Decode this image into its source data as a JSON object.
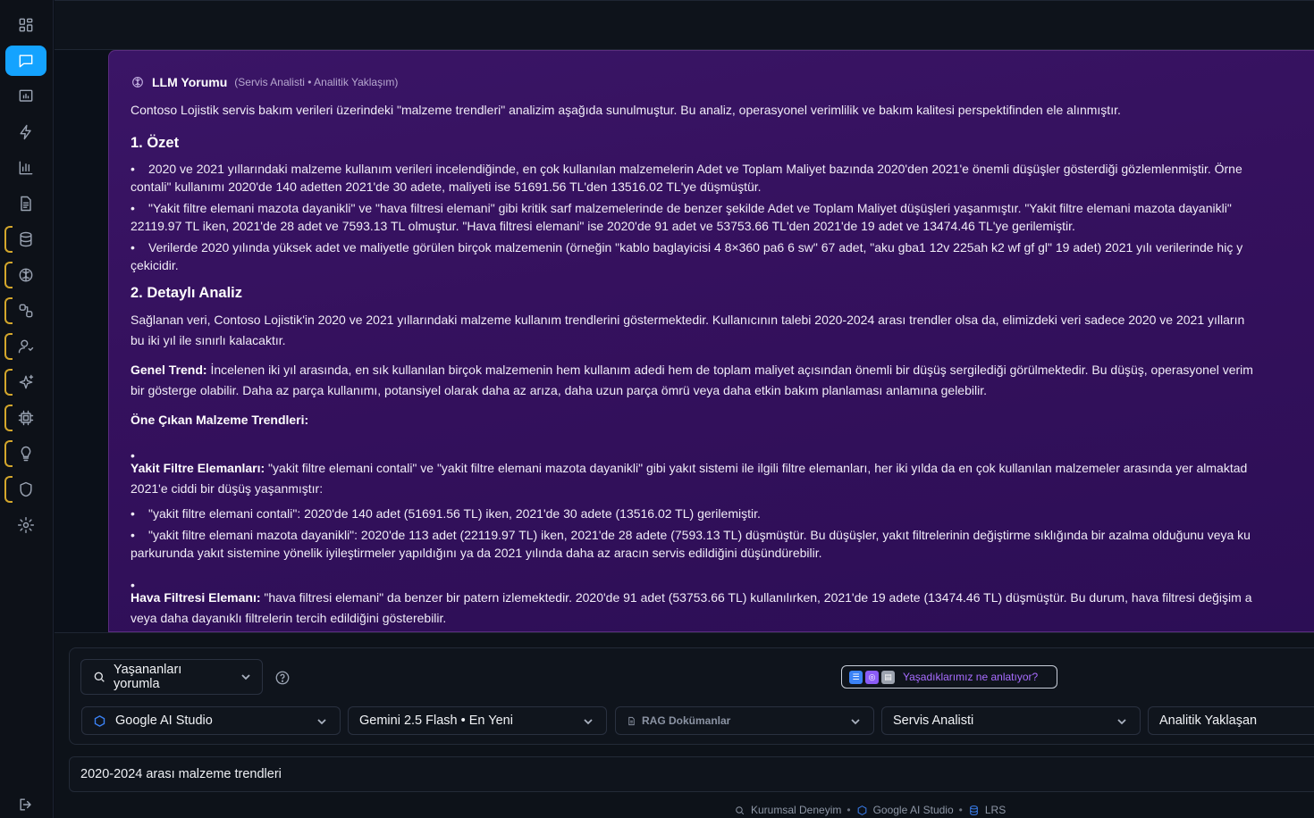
{
  "sidebar": {
    "items": [
      {
        "icon": "dashboard-icon"
      },
      {
        "icon": "chat-icon"
      },
      {
        "icon": "presentation-chart-icon"
      },
      {
        "icon": "lightning-icon"
      },
      {
        "icon": "bar-chart-icon"
      },
      {
        "icon": "document-icon"
      },
      {
        "icon": "database-icon"
      },
      {
        "icon": "brain-icon"
      },
      {
        "icon": "workflow-icon"
      },
      {
        "icon": "user-settings-icon"
      },
      {
        "icon": "sparkles-icon"
      },
      {
        "icon": "cpu-icon"
      },
      {
        "icon": "lightbulb-icon"
      },
      {
        "icon": "shield-icon"
      },
      {
        "icon": "gear-icon"
      }
    ],
    "logout_icon": "logout-icon"
  },
  "card": {
    "title": "LLM Yorumu",
    "subtitle": "(Servis Analisti • Analitik Yaklaşım)",
    "intro": "Contoso Lojistik servis bakım verileri üzerindeki \"malzeme trendleri\" analizim aşağıda sunulmuştur. Bu analiz, operasyonel verimlilik ve bakım kalitesi perspektifinden ele alınmıştır.",
    "section1_title": "1. Özet",
    "s1_b1_l1": "2020 ve 2021 yıllarındaki malzeme kullanım verileri incelendiğinde, en çok kullanılan malzemelerin Adet ve Toplam Maliyet bazında 2020'den 2021'e önemli düşüşler gösterdiği gözlemlenmiştir. Örne",
    "s1_b1_l2": "contali\" kullanımı 2020'de 140 adetten 2021'de 30 adete, maliyeti ise 51691.56 TL'den 13516.02 TL'ye düşmüştür.",
    "s1_b2_l1": "\"Yakit filtre elemani mazota dayanikli\" ve \"hava filtresi elemani\" gibi kritik sarf malzemelerinde de benzer şekilde Adet ve Toplam Maliyet düşüşleri yaşanmıştır. \"Yakit filtre elemani mazota dayanikli\"",
    "s1_b2_l2": "22119.97 TL iken, 2021'de 28 adet ve 7593.13 TL olmuştur. \"Hava filtresi elemani\" ise 2020'de 91 adet ve 53753.66 TL'den 2021'de 19 adet ve 13474.46 TL'ye gerilemiştir.",
    "s1_b3_l1": "Verilerde 2020 yılında yüksek adet ve maliyetle görülen birçok malzemenin (örneğin \"kablo baglayicisi 4 8×360 pa6 6 sw\" 67 adet, \"aku gba1 12v 225ah k2 wf gf gl\" 19 adet) 2021 yılı verilerinde hiç y",
    "s1_b3_l2": "çekicidir.",
    "section2_title": "2. Detaylı Analiz",
    "s2_p1_l1": "Sağlanan veri, Contoso Lojistik'in 2020 ve 2021 yıllarındaki malzeme kullanım trendlerini göstermektedir. Kullanıcının talebi 2020-2024 arası trendler olsa da, elimizdeki veri sadece 2020 ve 2021 yılların",
    "s2_p1_l2": "bu iki yıl ile sınırlı kalacaktır.",
    "s2_p2_label": "Genel Trend:",
    "s2_p2_l1": " İncelenen iki yıl arasında, en sık kullanılan birçok malzemenin hem kullanım adedi hem de toplam maliyet açısından önemli bir düşüş sergilediği görülmektedir. Bu düşüş, operasyonel verim",
    "s2_p2_l2": "bir gösterge olabilir. Daha az parça kullanımı, potansiyel olarak daha az arıza, daha uzun parça ömrü veya daha etkin bakım planlaması anlamına gelebilir.",
    "s2_h3": "Öne Çıkan Malzeme Trendleri:",
    "s2_p3_label": "Yakit Filtre Elemanları:",
    "s2_p3_l1": " \"yakit filtre elemani contali\" ve \"yakit filtre elemani mazota dayanikli\" gibi yakıt sistemi ile ilgili filtre elemanları, her iki yılda da en çok kullanılan malzemeler arasında yer almaktad",
    "s2_p3_l2": "2021'e ciddi bir düşüş yaşanmıştır:",
    "s2_b1": "\"yakit filtre elemani contali\": 2020'de 140 adet (51691.56 TL) iken, 2021'de 30 adete (13516.02 TL) gerilemiştir.",
    "s2_b2_l1": "\"yakit filtre elemani mazota dayanikli\": 2020'de 113 adet (22119.97 TL) iken, 2021'de 28 adete (7593.13 TL) düşmüştür. Bu düşüşler, yakıt filtrelerinin değiştirme sıklığında bir azalma olduğunu veya ku",
    "s2_b2_l2": "parkurunda yakıt sistemine yönelik iyileştirmeler yapıldığını ya da 2021 yılında daha az aracın servis edildiğini düşündürebilir.",
    "s2_p4_label": "Hava Filtresi Elemanı:",
    "s2_p4_l1": " \"hava filtresi elemani\" da benzer bir patern izlemektedir. 2020'de 91 adet (53753.66 TL) kullanılırken, 2021'de 19 adete (13474.46 TL) düşmüştür. Bu durum, hava filtresi değişim a",
    "s2_p4_l2": "veya daha dayanıklı filtrelerin tercih edildiğini gösterebilir."
  },
  "controls": {
    "mode_label": "Yaşananları yorumla",
    "ask_label": "Yaşadıklarımız ne anlatıyor?",
    "provider": "Google AI Studio",
    "model": "Gemini 2.5 Flash • En Yeni",
    "rag": "RAG Dokümanlar",
    "role": "Servis Analisti",
    "approach": "Analitik Yaklaşan",
    "query": "2020-2024 arası malzeme trendleri"
  },
  "footer": {
    "item1": "Kurumsal Deneyim",
    "sep": "•",
    "item2": "Google AI Studio",
    "item3": "LRS"
  },
  "colors": {
    "active_accent": "#14a3ff",
    "card_bg": "#35115e",
    "ask_text": "#a86cff",
    "sidebar_flag": "#d4a72c"
  }
}
